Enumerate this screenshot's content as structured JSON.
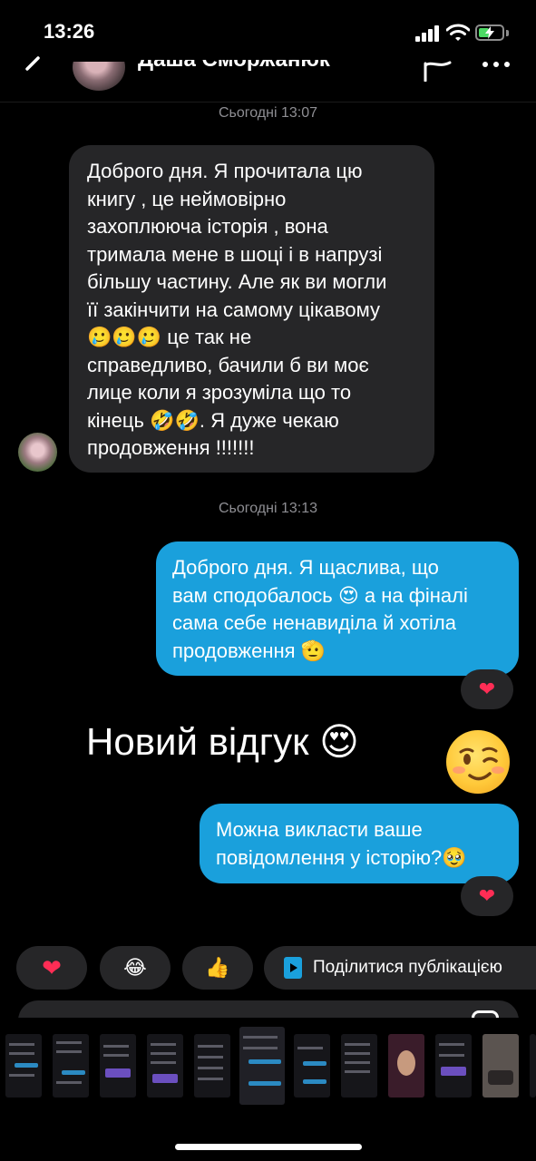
{
  "status_bar": {
    "time": "13:26"
  },
  "header": {
    "contact_name": "Даша Сморжанюк"
  },
  "messages": [
    {
      "type": "date",
      "text": "Сьогодні 13:07"
    },
    {
      "type": "incoming",
      "lines": [
        "Доброго дня. Я прочитала цю",
        "книгу , це неймовірно",
        "захоплююча історія , вона",
        "тримала мене в шоці і в напрузі",
        "більшу частину. Але як ви могли",
        "її закінчити на самому цікавому",
        "🥲🥲🥲 це так не",
        "справедливо, бачили б ви моє",
        "лице коли я зрозуміла що то",
        "кінець 🤣🤣. Я дуже чекаю",
        "продовження !!!!!!!"
      ]
    },
    {
      "type": "date",
      "text": "Сьогодні 13:13"
    },
    {
      "type": "outgoing",
      "lines": [
        "Доброго дня. Я щаслива, що",
        "вам сподобалось 😍 а на фіналі",
        "сама себе ненавиділа й хотіла",
        "продовження 🫡"
      ],
      "reaction": "❤"
    },
    {
      "type": "overlay_text",
      "text": "Новий відгук 😍"
    },
    {
      "type": "outgoing",
      "lines": [
        "Можна викласти ваше",
        "повідомлення у історію?🥹"
      ],
      "reaction": "❤"
    }
  ],
  "quick_reactions": [
    "❤",
    "😂",
    "👍"
  ],
  "share_action": {
    "label": "Поділитися публікацією"
  },
  "colors": {
    "background": "#000000",
    "incoming_bubble": "#262628",
    "outgoing_bubble": "#1aa0dc",
    "heart": "#ff2d55",
    "muted_text": "#8e8e93"
  },
  "icons": {
    "back": "chevron-left-icon",
    "flag": "flag-icon",
    "more": "more-icon",
    "signal": "signal-icon",
    "wifi": "wifi-icon",
    "battery": "battery-charging-icon",
    "share": "play-icon"
  }
}
